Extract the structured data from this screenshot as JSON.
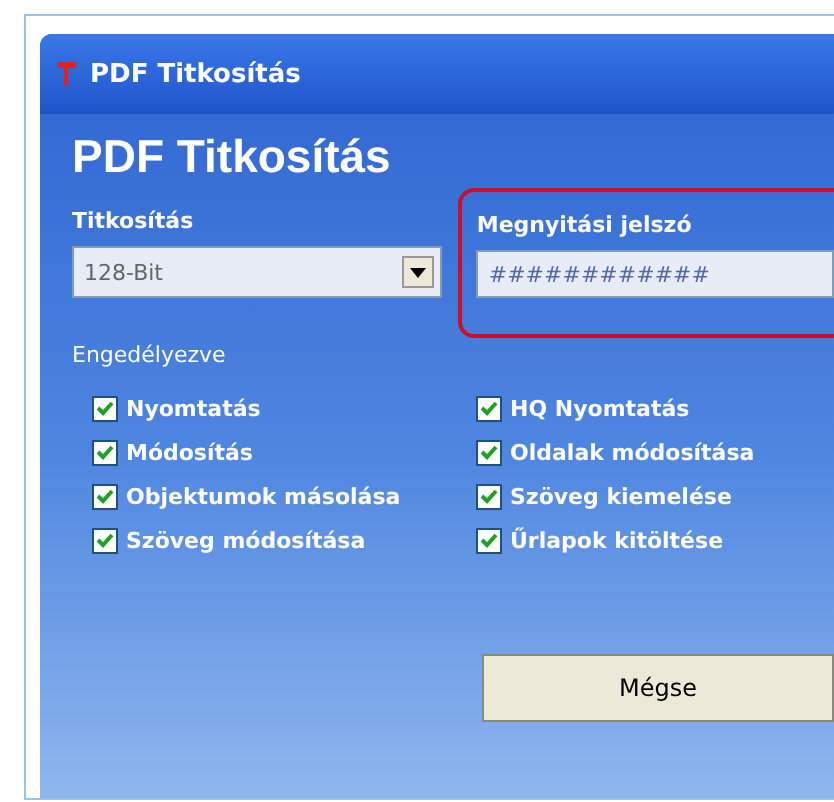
{
  "window": {
    "title": "PDF Titkosítás"
  },
  "heading": "PDF Titkosítás",
  "encryption": {
    "label": "Titkosítás",
    "value": "128-Bit"
  },
  "password": {
    "label": "Megnyitási jelszó",
    "value": "############",
    "highlighted": true
  },
  "permissions": {
    "label": "Engedélyezve",
    "items": [
      {
        "label": "Nyomtatás",
        "checked": true
      },
      {
        "label": "HQ Nyomtatás",
        "checked": true
      },
      {
        "label": "Módosítás",
        "checked": true
      },
      {
        "label": "Oldalak módosítása",
        "checked": true
      },
      {
        "label": "Objektumok másolása",
        "checked": true
      },
      {
        "label": "Szöveg kiemelése",
        "checked": true
      },
      {
        "label": "Szöveg módosítása",
        "checked": true
      },
      {
        "label": "Űrlapok kitöltése",
        "checked": true
      }
    ]
  },
  "buttons": [
    "Mégse"
  ]
}
